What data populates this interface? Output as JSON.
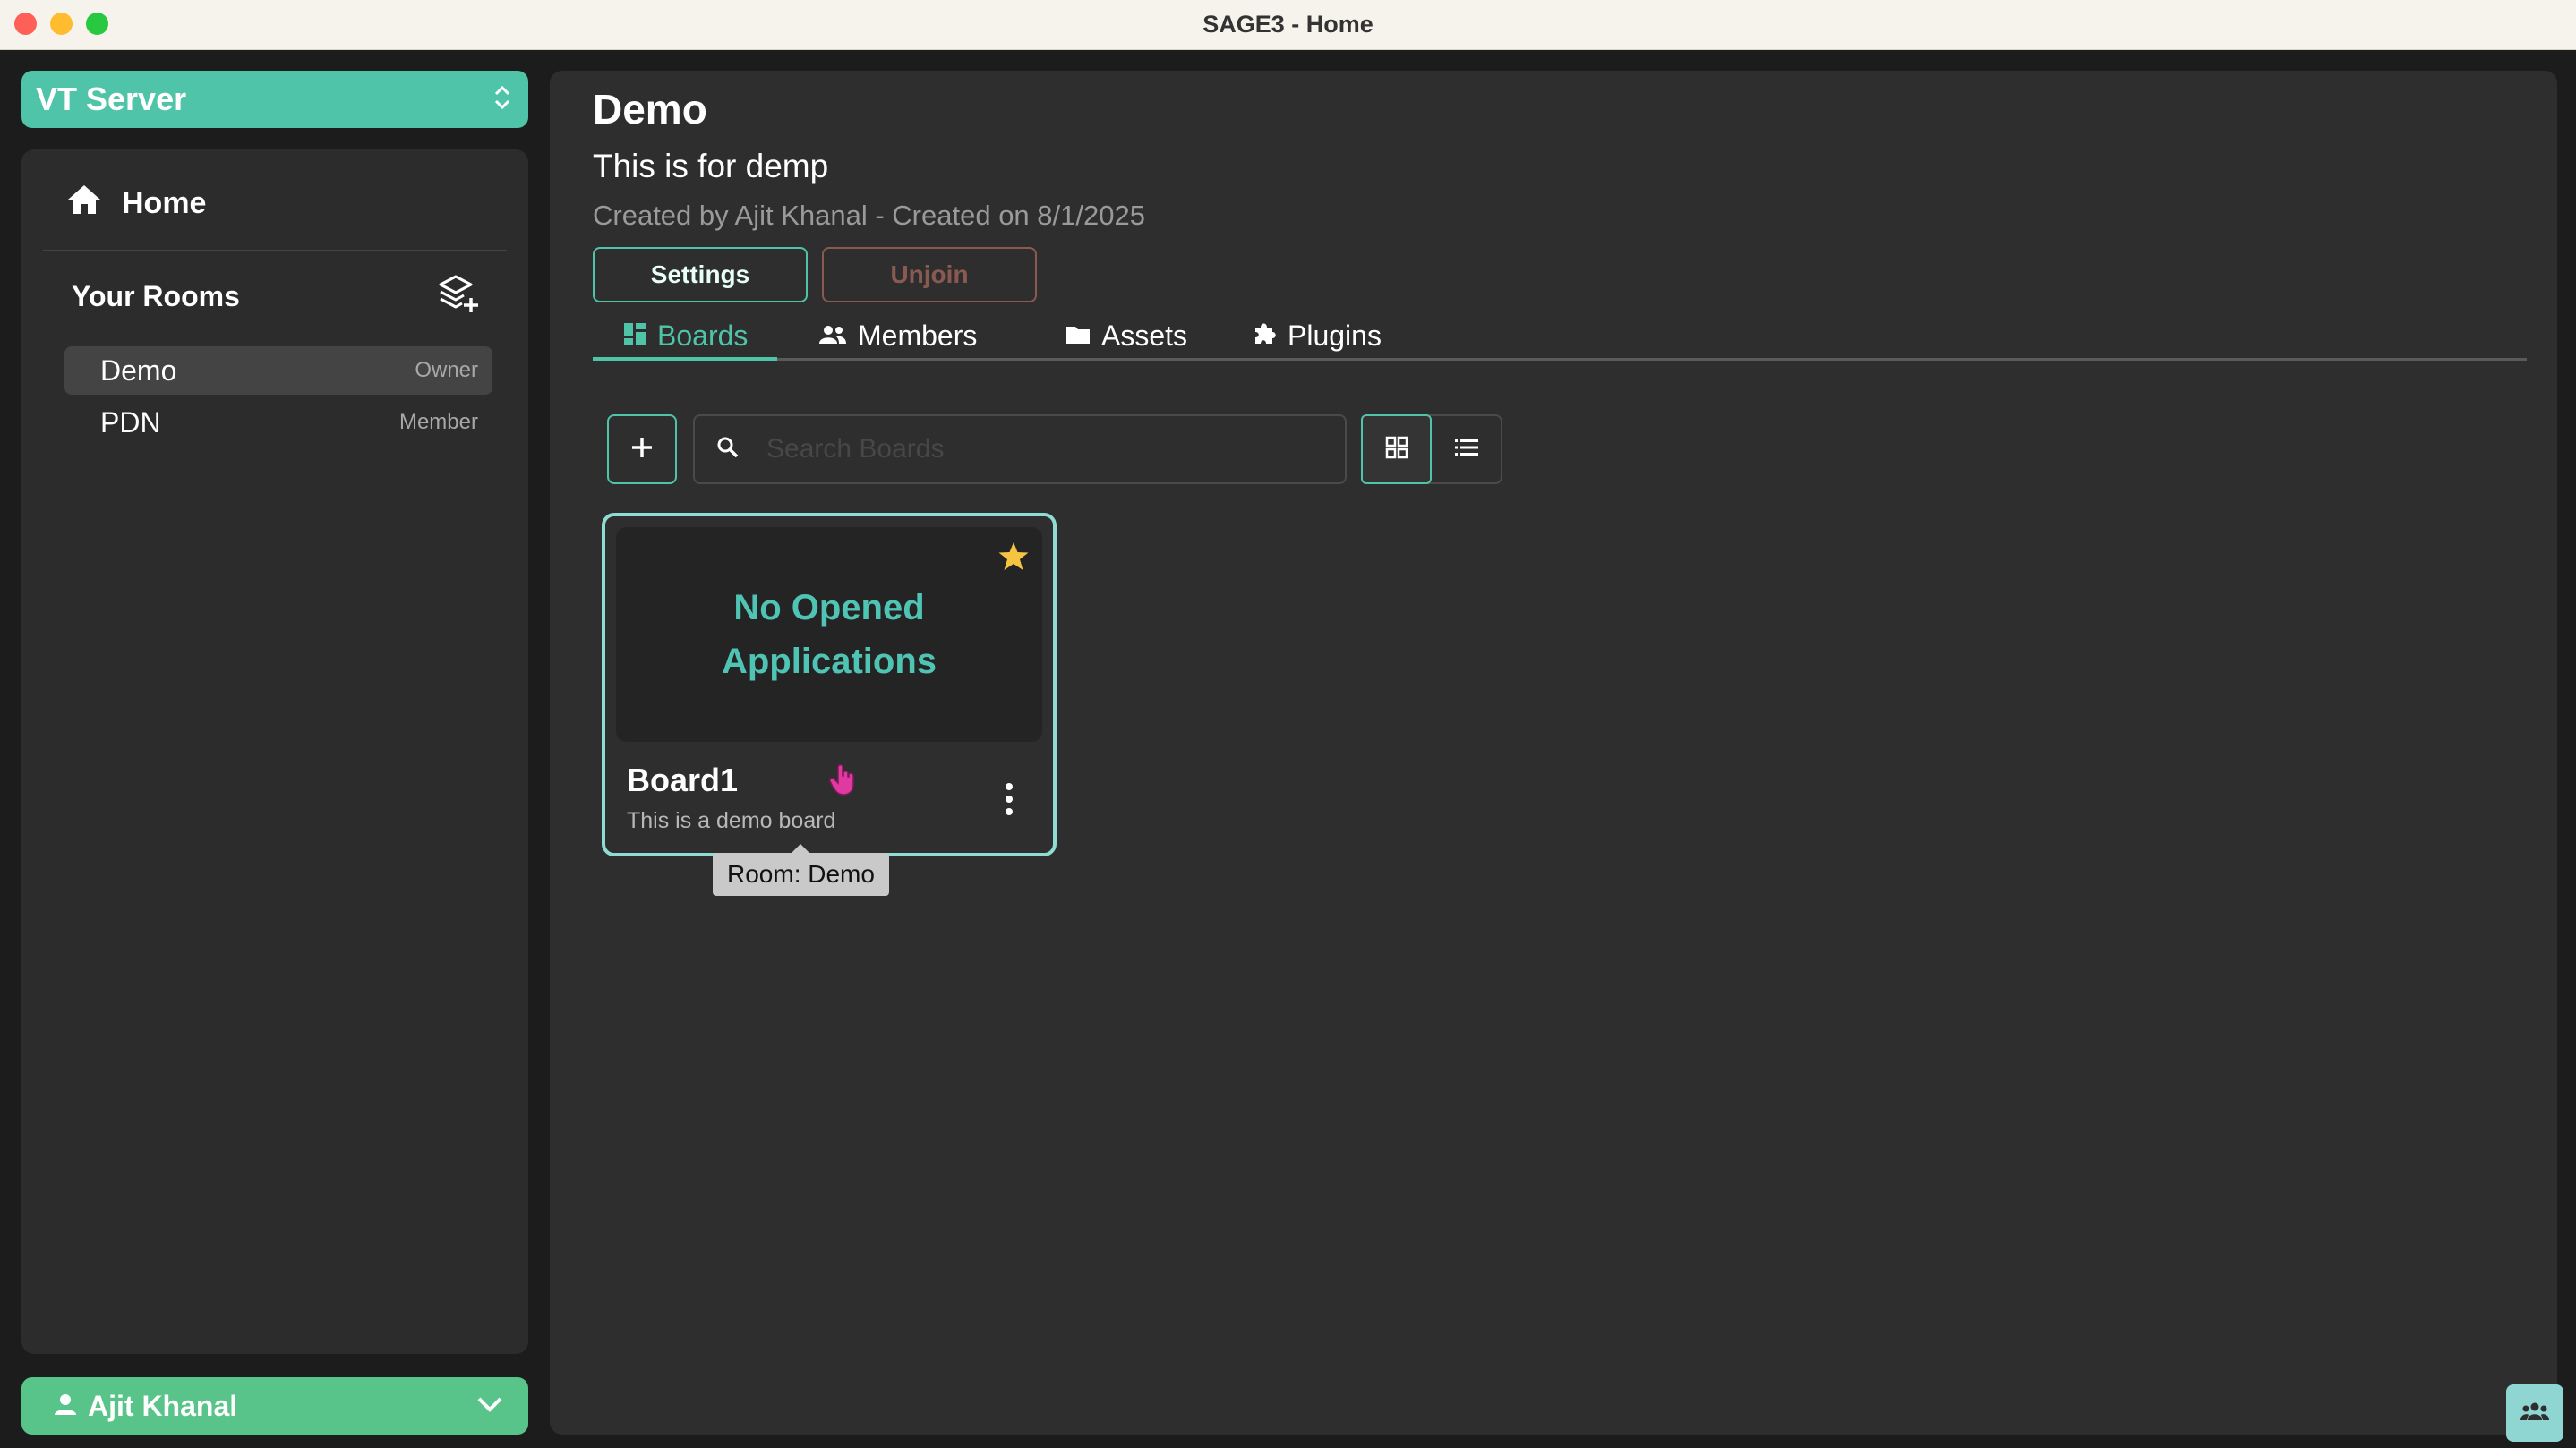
{
  "window": {
    "title": "SAGE3 - Home"
  },
  "sidebar": {
    "server": {
      "name": "VT Server"
    },
    "home_label": "Home",
    "rooms_title": "Your Rooms",
    "rooms": [
      {
        "name": "Demo",
        "role": "Owner",
        "active": true
      },
      {
        "name": "PDN",
        "role": "Member",
        "active": false
      }
    ],
    "user": {
      "name": "Ajit Khanal"
    }
  },
  "room": {
    "title": "Demo",
    "description": "This is for demp",
    "meta": "Created by Ajit Khanal  - Created on 8/1/2025",
    "settings_label": "Settings",
    "unjoin_label": "Unjoin"
  },
  "tabs": [
    {
      "label": "Boards",
      "icon": "boards-icon",
      "active": true
    },
    {
      "label": "Members",
      "icon": "members-icon",
      "active": false
    },
    {
      "label": "Assets",
      "icon": "folder-icon",
      "active": false
    },
    {
      "label": "Plugins",
      "icon": "puzzle-icon",
      "active": false
    }
  ],
  "search": {
    "placeholder": "Search Boards",
    "value": ""
  },
  "view": {
    "mode": "grid"
  },
  "boards": [
    {
      "name": "Board1",
      "description": "This is a demo board",
      "preview_text": "No Opened Applications",
      "starred": true,
      "tooltip": "Room: Demo"
    }
  ],
  "colors": {
    "accent": "#4fc4a8",
    "user_menu": "#58c48a",
    "star": "#f5c542",
    "preview_text": "#4fc4b4",
    "danger_outline": "#8a5a52"
  }
}
